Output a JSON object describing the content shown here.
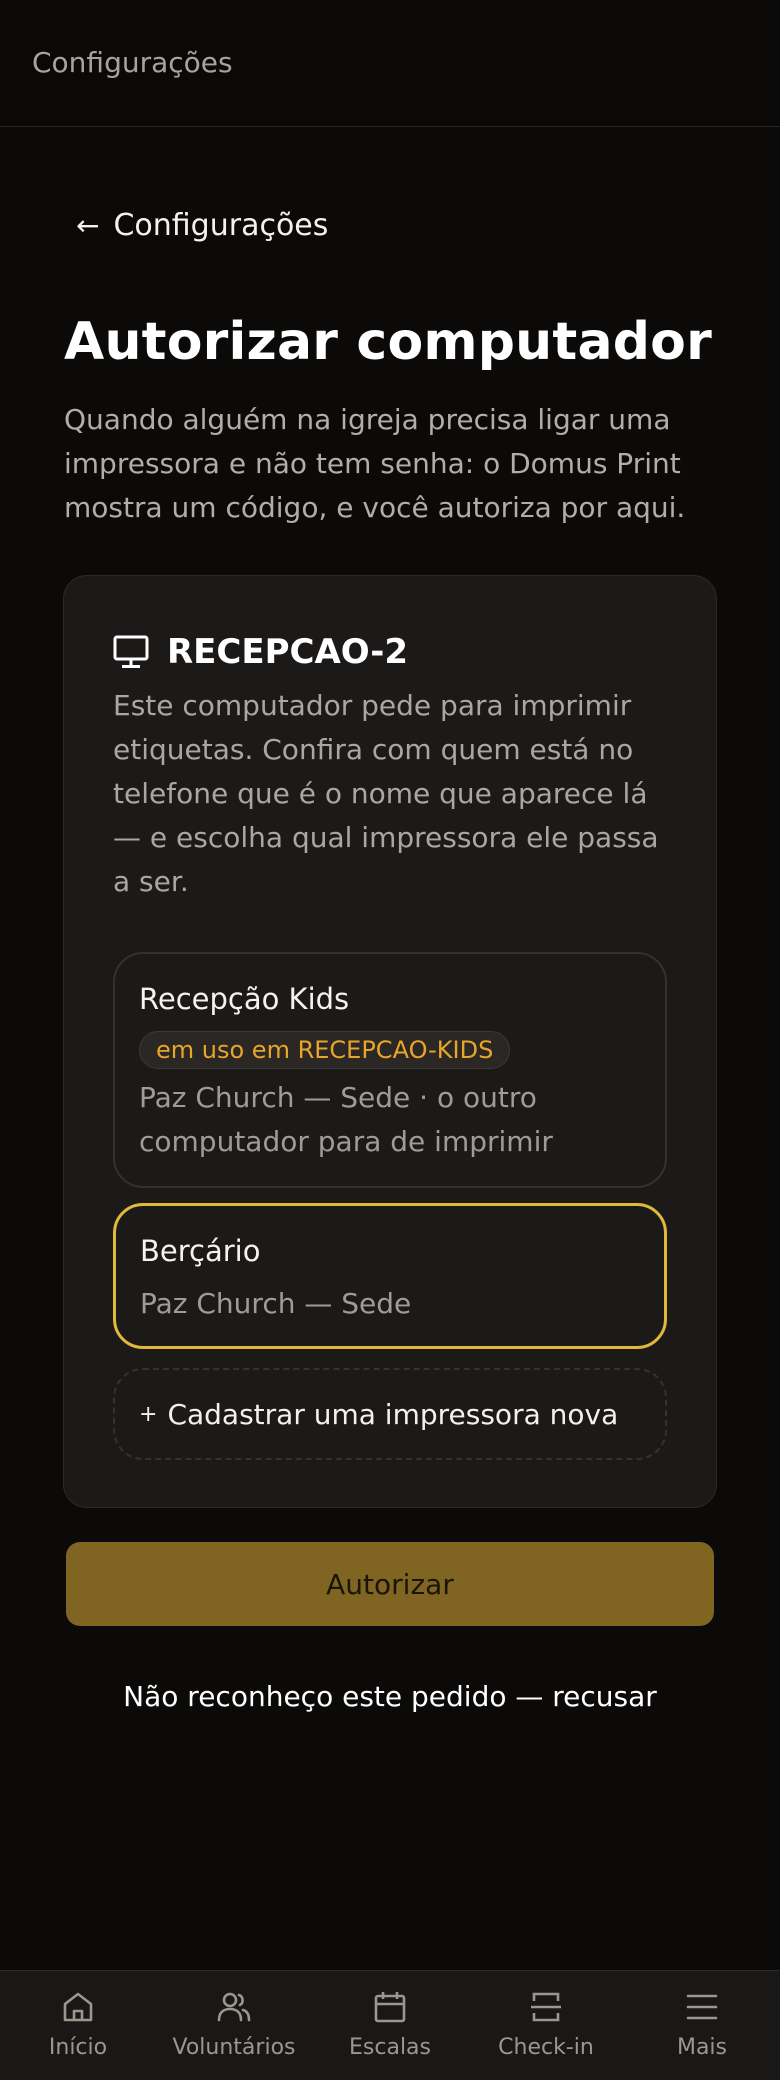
{
  "topbar": {
    "title": "Configurações"
  },
  "back": {
    "arrow": "←",
    "label": "Configurações"
  },
  "page": {
    "title": "Autorizar computador",
    "description": "Quando alguém na igreja precisa ligar uma impressora e não tem senha: o Domus Print mostra um código, e você autoriza por aqui."
  },
  "request": {
    "device_icon": "monitor-icon",
    "device_name": "RECEPCAO-2",
    "description": "Este computador pede para imprimir etiquetas. Confira com quem está no telefone que é o nome que aparece lá — e escolha qual impressora ele passa a ser."
  },
  "printers": [
    {
      "name": "Recepção Kids",
      "badge": "em uso em RECEPCAO-KIDS",
      "note": "Paz Church — Sede · o outro computador para de imprimir",
      "selected": false
    },
    {
      "name": "Berçário",
      "note": "Paz Church — Sede",
      "selected": true
    }
  ],
  "add_printer": {
    "plus": "+",
    "label": "Cadastrar uma impressora nova"
  },
  "actions": {
    "authorize": "Autorizar",
    "refuse": "Não reconheço este pedido — recusar"
  },
  "nav": [
    {
      "label": "Início",
      "icon": "home-icon"
    },
    {
      "label": "Voluntários",
      "icon": "users-icon"
    },
    {
      "label": "Escalas",
      "icon": "calendar-icon"
    },
    {
      "label": "Check-in",
      "icon": "checkin-icon"
    },
    {
      "label": "Mais",
      "icon": "menu-icon"
    }
  ],
  "colors": {
    "background": "#0b0a09",
    "card": "#1c1a18",
    "accent": "#e0b93a",
    "button": "#7f6521",
    "badge_text": "#e9a52a"
  }
}
